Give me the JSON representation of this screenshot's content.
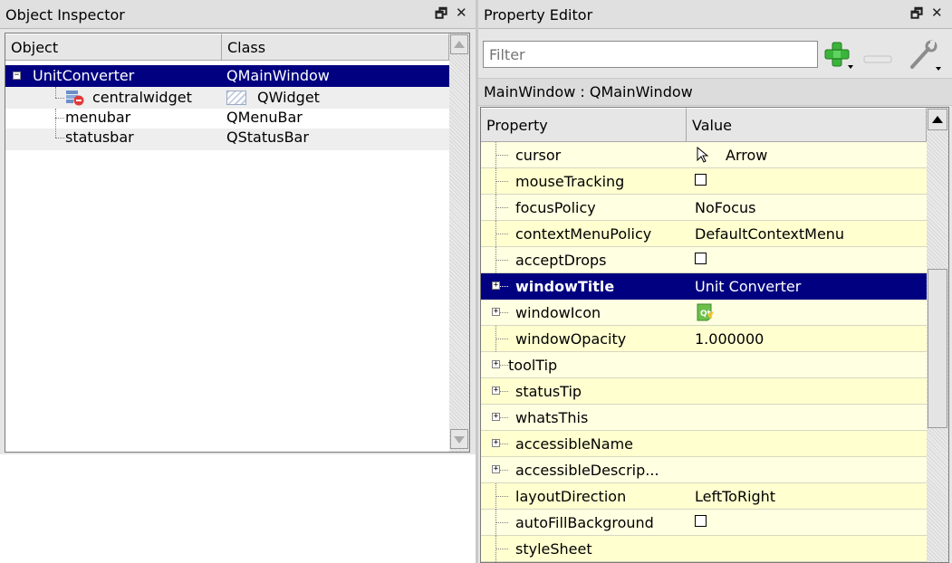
{
  "object_inspector": {
    "title": "Object Inspector",
    "columns": [
      "Object",
      "Class"
    ],
    "rows": [
      {
        "object": "UnitConverter",
        "class": "QMainWindow"
      },
      {
        "object": "centralwidget",
        "class": "QWidget"
      },
      {
        "object": "menubar",
        "class": "QMenuBar"
      },
      {
        "object": "statusbar",
        "class": "QStatusBar"
      }
    ]
  },
  "property_editor": {
    "title": "Property Editor",
    "filter_placeholder": "Filter",
    "context": "MainWindow : QMainWindow",
    "columns": [
      "Property",
      "Value"
    ],
    "rows": [
      {
        "name": "cursor",
        "value": "Arrow"
      },
      {
        "name": "mouseTracking",
        "value": ""
      },
      {
        "name": "focusPolicy",
        "value": "NoFocus"
      },
      {
        "name": "contextMenuPolicy",
        "value": "DefaultContextMenu"
      },
      {
        "name": "acceptDrops",
        "value": ""
      },
      {
        "name": "windowTitle",
        "value": "Unit Converter"
      },
      {
        "name": "windowIcon",
        "value": ""
      },
      {
        "name": "windowOpacity",
        "value": "1.000000"
      },
      {
        "name": "toolTip",
        "value": ""
      },
      {
        "name": "statusTip",
        "value": ""
      },
      {
        "name": "whatsThis",
        "value": ""
      },
      {
        "name": "accessibleName",
        "value": ""
      },
      {
        "name": "accessibleDescrip...",
        "value": ""
      },
      {
        "name": "layoutDirection",
        "value": "LeftToRight"
      },
      {
        "name": "autoFillBackground",
        "value": ""
      },
      {
        "name": "styleSheet",
        "value": ""
      }
    ]
  },
  "icons": {
    "float": "float-icon",
    "close": "close-icon",
    "add": "add-dynamic-property-icon",
    "remove": "remove-dynamic-property-icon",
    "configure": "wrench-icon"
  },
  "colors": {
    "selection": "#000080",
    "property_bg": "#ffffe1",
    "property_bg_alt": "#ffffd0"
  }
}
